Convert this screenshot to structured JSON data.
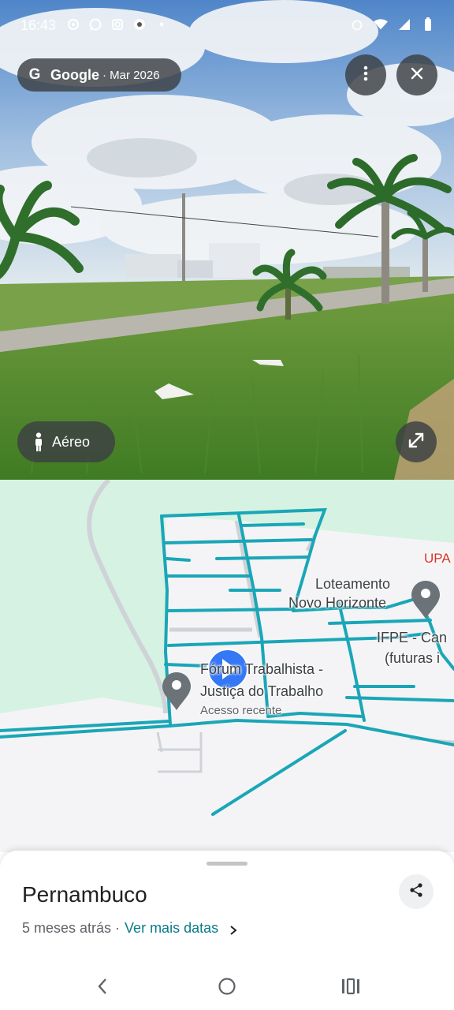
{
  "status_bar": {
    "time": "16:43",
    "left_icons": [
      "location-icon",
      "whatsapp-icon",
      "instagram-icon",
      "app-icon",
      "dot-icon"
    ],
    "right_icons": [
      "alarm-icon",
      "wifi-icon",
      "signal-icon",
      "battery-icon"
    ]
  },
  "street_view": {
    "brand": "Google",
    "date": "· Mar 2026",
    "aerial_label": "Aéreo",
    "icons": {
      "more": "more-vert-icon",
      "close": "close-icon",
      "person": "person-icon",
      "expand": "expand-icon"
    }
  },
  "map": {
    "labels": {
      "upa": "UPA",
      "loteamento_line1": "Loteamento",
      "loteamento_line2": "Novo Horizonte",
      "ifpe_line1": "IFPE - Can",
      "ifpe_line2": "(futuras i",
      "forum_line1": "Fórum Trabalhista -",
      "forum_line2": "Justiça do Trabalho",
      "forum_sub": "Acesso recente"
    },
    "colors": {
      "coverage_line": "#1aa6b7",
      "park": "#d6f2e2",
      "road": "#cfd3d8"
    }
  },
  "sheet": {
    "title": "Pernambuco",
    "age": "5 meses atrás ·",
    "more_dates": "Ver mais datas"
  }
}
